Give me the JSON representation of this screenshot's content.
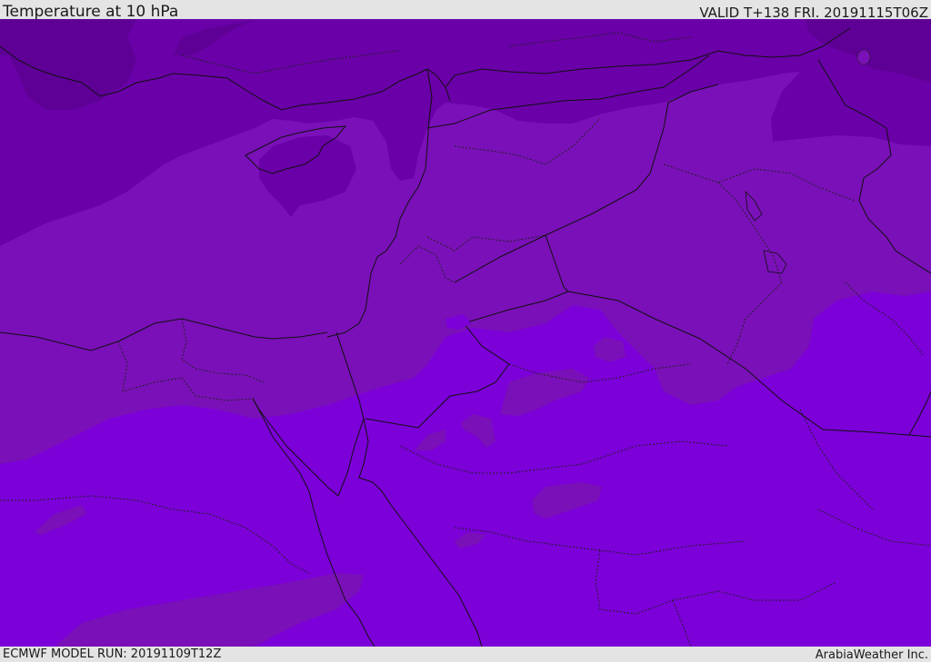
{
  "header": {
    "title": "Temperature at 10 hPa",
    "valid": "VALID T+138 FRI. 20191115T06Z"
  },
  "footer": {
    "model_run": "ECMWF MODEL RUN: 20191109T12Z",
    "credit": "ArabiaWeather Inc."
  },
  "map": {
    "region": "Middle East and North Africa",
    "colors": {
      "band_darkest": "#5e0096",
      "band_dark": "#6a00a8",
      "band_mid": "#7a10b8",
      "band_light": "#7c00d8",
      "border_line": "#111111"
    }
  }
}
